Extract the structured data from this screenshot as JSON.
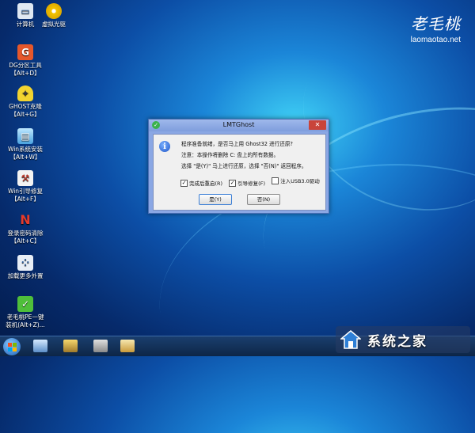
{
  "desktop": {
    "icons": [
      {
        "label": "计算机",
        "icon": "computer-icon"
      },
      {
        "label": "虚拟光驱",
        "icon": "virtual-drive-icon"
      },
      {
        "label": "DG分区工具\n【Alt+D】",
        "icon": "partition-tool-icon"
      },
      {
        "label": "GHOST克隆\n【Alt+G】",
        "icon": "ghost-icon"
      },
      {
        "label": "Win系统安装\n【Alt+W】",
        "icon": "win-install-icon"
      },
      {
        "label": "Win引导修复\n【Alt+F】",
        "icon": "boot-repair-icon"
      },
      {
        "label": "登录密码清除\n【Alt+C】",
        "icon": "password-clear-icon"
      },
      {
        "label": "加载更多外置",
        "icon": "load-more-icon"
      },
      {
        "label": "老毛桃PE一键\n装机(Alt+Z)...",
        "icon": "onekey-install-icon"
      }
    ]
  },
  "brand": {
    "name": "老毛桃",
    "url": "laomaotao.net"
  },
  "dialog": {
    "title": "LMTGhost",
    "close_label": "✕",
    "line1": "程序准备就绪，是否马上用 Ghost32 进行还原?",
    "line2": "注意：本操作将删除 C: 盘上的所有数据。",
    "line3": "选择 \"是(Y)\" 马上进行还原，选择 \"否(N)\" 返回程序。",
    "checkboxes": [
      {
        "label": "完成后重启(R)",
        "checked": true
      },
      {
        "label": "引导修复(F)",
        "checked": true
      },
      {
        "label": "注入USB3.0驱动",
        "checked": false
      }
    ],
    "yes_label": "是(Y)",
    "no_label": "否(N)"
  },
  "taskbar": {
    "watermark_text": "系统之家"
  },
  "colors": {
    "dialog_frame": "#8aa7e4",
    "close_red": "#c9443a",
    "taskbar": "#0d2647"
  }
}
